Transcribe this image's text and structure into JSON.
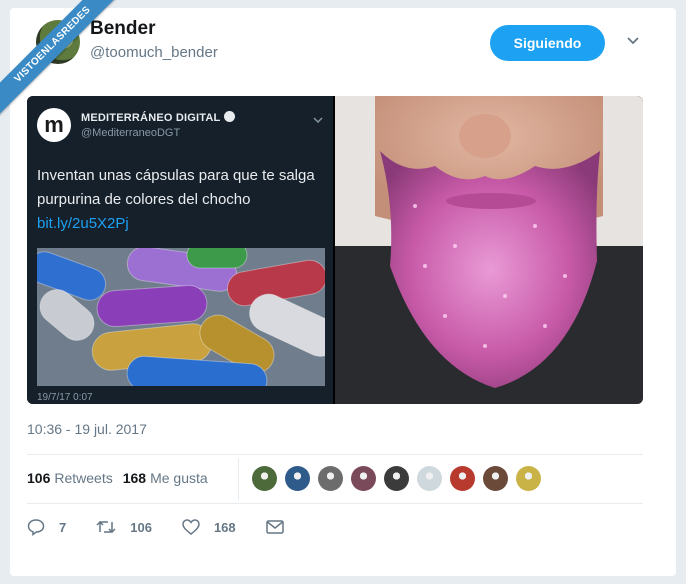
{
  "watermark": {
    "text": "VISTOENLASREDES"
  },
  "author": {
    "name": "Bender",
    "handle": "@toomuch_bender"
  },
  "follow_button": {
    "label": "Siguiendo"
  },
  "quoted_tweet": {
    "logo_letter": "m",
    "account_name": "MEDITERRÁNEO DIGITAL",
    "account_handle": "@MediterraneoDGT",
    "text": "Inventan unas cápsulas para que te salga purpurina de colores del chocho",
    "link": "bit.ly/2u5X2Pj",
    "date": "19/7/17 0:07"
  },
  "timestamp": "10:36 - 19 jul. 2017",
  "stats": {
    "retweets_count": "106",
    "retweets_label": "Retweets",
    "likes_count": "168",
    "likes_label": "Me gusta"
  },
  "likers": [
    "#4d6a3a",
    "#2f5b8a",
    "#6c6c6c",
    "#7a4a5a",
    "#3b3b3b",
    "#cfd8dc",
    "#b83a2e",
    "#6b4a3a",
    "#c9b347"
  ],
  "actions": {
    "replies": "7",
    "retweets": "106",
    "likes": "168"
  },
  "colors": {
    "accent": "#1da1f2",
    "glitter": "#c85aa8"
  }
}
